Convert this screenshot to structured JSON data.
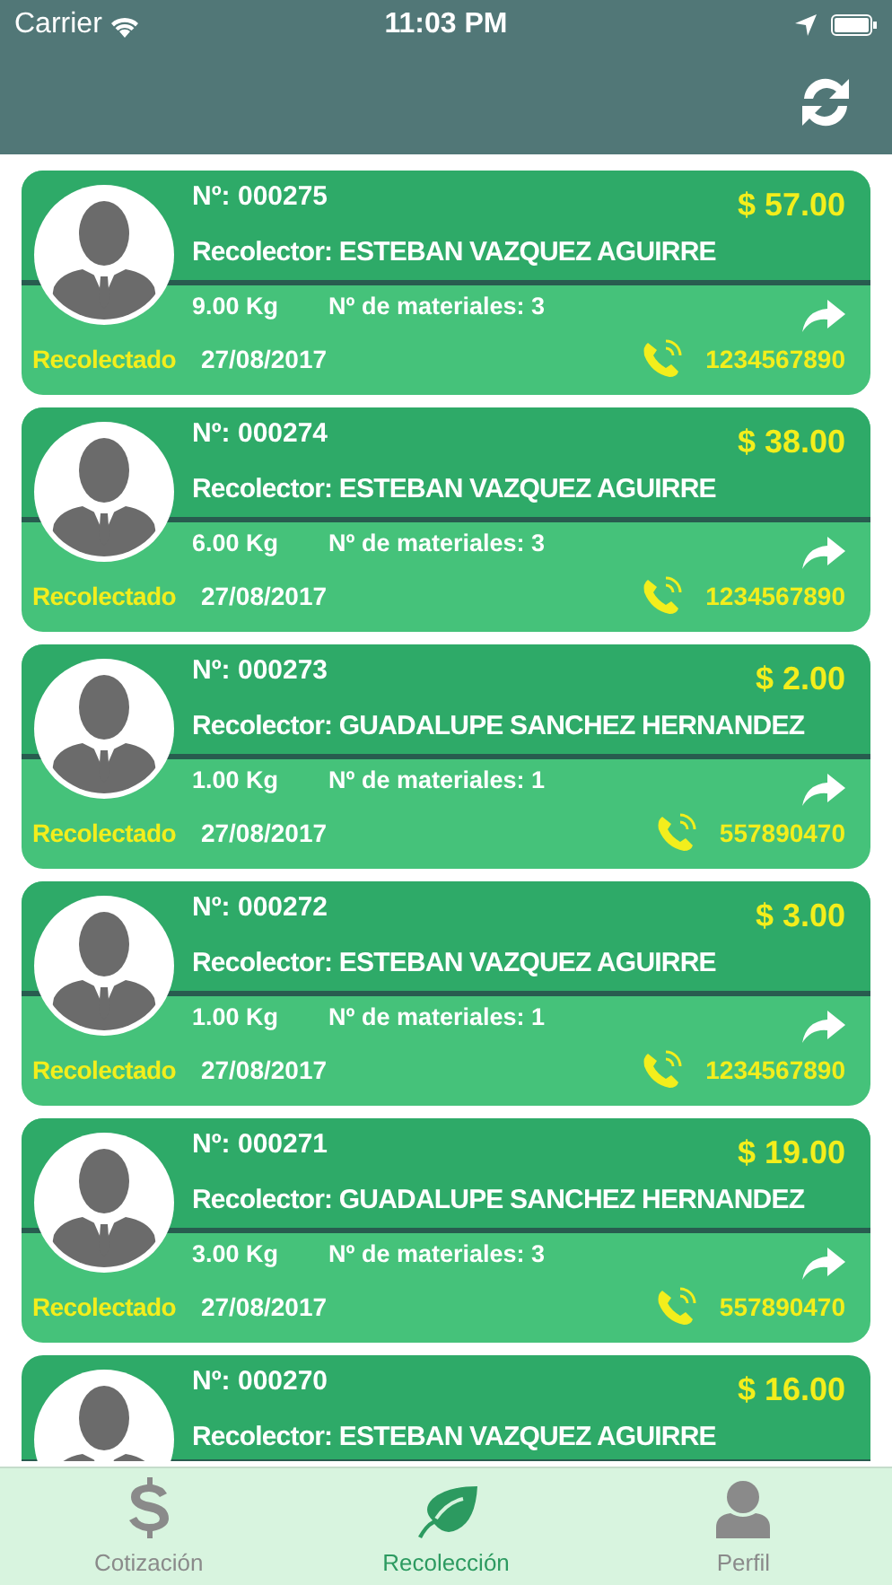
{
  "status_bar": {
    "carrier": "Carrier",
    "time": "11:03 PM"
  },
  "cards": [
    {
      "number": "Nº: 000275",
      "price": "$ 57.00",
      "collector": "Recolector: ESTEBAN VAZQUEZ AGUIRRE",
      "weight": "9.00 Kg",
      "materials": "Nº de materiales: 3",
      "status": "Recolectado",
      "date": "27/08/2017",
      "phone": "1234567890"
    },
    {
      "number": "Nº: 000274",
      "price": "$ 38.00",
      "collector": "Recolector: ESTEBAN VAZQUEZ AGUIRRE",
      "weight": "6.00 Kg",
      "materials": "Nº de materiales: 3",
      "status": "Recolectado",
      "date": "27/08/2017",
      "phone": "1234567890"
    },
    {
      "number": "Nº: 000273",
      "price": "$ 2.00",
      "collector": "Recolector: GUADALUPE SANCHEZ HERNANDEZ",
      "weight": "1.00 Kg",
      "materials": "Nº de materiales: 1",
      "status": "Recolectado",
      "date": "27/08/2017",
      "phone": "557890470"
    },
    {
      "number": "Nº: 000272",
      "price": "$ 3.00",
      "collector": "Recolector: ESTEBAN VAZQUEZ AGUIRRE",
      "weight": "1.00 Kg",
      "materials": "Nº de materiales: 1",
      "status": "Recolectado",
      "date": "27/08/2017",
      "phone": "1234567890"
    },
    {
      "number": "Nº: 000271",
      "price": "$ 19.00",
      "collector": "Recolector: GUADALUPE SANCHEZ HERNANDEZ",
      "weight": "3.00 Kg",
      "materials": "Nº de materiales: 3",
      "status": "Recolectado",
      "date": "27/08/2017",
      "phone": "557890470"
    },
    {
      "number": "Nº: 000270",
      "price": "$ 16.00",
      "collector": "Recolector: ESTEBAN VAZQUEZ AGUIRRE"
    }
  ],
  "tabs": [
    {
      "kind": "dollar",
      "label": "Cotización",
      "selected": false
    },
    {
      "kind": "leaf",
      "label": "Recolección",
      "selected": true
    },
    {
      "kind": "person",
      "label": "Perfil",
      "selected": false
    }
  ]
}
